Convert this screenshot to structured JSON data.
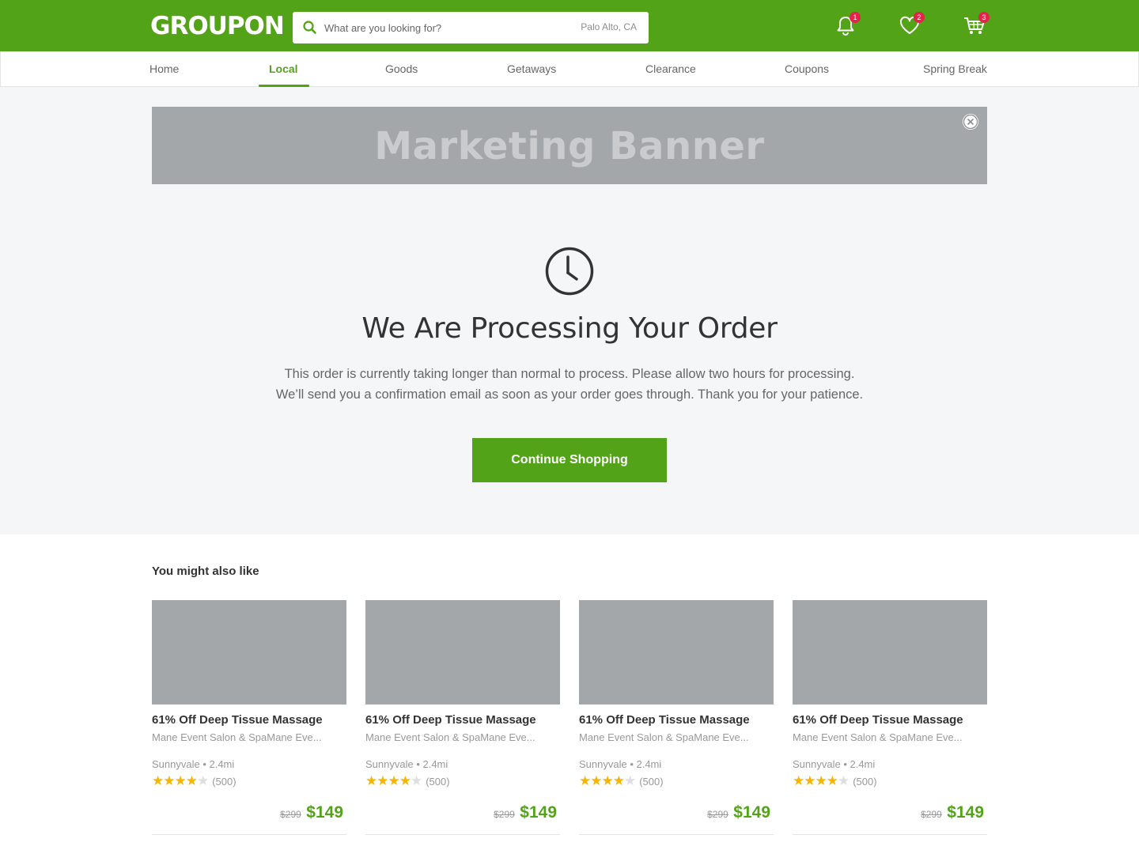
{
  "brand": {
    "logo_text": "GROUPON",
    "accent": "#53a318",
    "badge_color": "#e5234b"
  },
  "header": {
    "search_placeholder": "What are you looking for?",
    "location": "Palo Alto, CA",
    "search_icon": "search-icon",
    "notifications": {
      "icon": "bell-icon",
      "count": "1"
    },
    "wishlist": {
      "icon": "heart-icon",
      "count": "2"
    },
    "cart": {
      "icon": "cart-icon",
      "count": "3"
    }
  },
  "nav": {
    "active": "Local",
    "items": [
      "Home",
      "Local",
      "Goods",
      "Getaways",
      "Clearance",
      "Coupons",
      "Spring Break"
    ]
  },
  "banner": {
    "text": "Marketing Banner",
    "close_icon": "close-icon"
  },
  "processing": {
    "icon": "clock-icon",
    "title": "We Are Processing Your Order",
    "line1": "This order is currently taking longer than normal to process. Please allow two hours for processing.",
    "line2": "We’ll send you a confirmation email as soon as your order goes through. Thank you for your patience.",
    "cta": "Continue Shopping"
  },
  "recommendations": {
    "title": "You might also like",
    "cards": [
      {
        "title": "61% Off Deep Tissue Massage",
        "merchant": "Mane Event Salon & SpaMane Eve...",
        "location": "Sunnyvale • 2.4mi",
        "rating": 4,
        "reviews": "(500)",
        "old_price": "$299",
        "price": "$149"
      },
      {
        "title": "61% Off Deep Tissue Massage",
        "merchant": "Mane Event Salon & SpaMane Eve...",
        "location": "Sunnyvale • 2.4mi",
        "rating": 4,
        "reviews": "(500)",
        "old_price": "$299",
        "price": "$149"
      },
      {
        "title": "61% Off Deep Tissue Massage",
        "merchant": "Mane Event Salon & SpaMane Eve...",
        "location": "Sunnyvale • 2.4mi",
        "rating": 4,
        "reviews": "(500)",
        "old_price": "$299",
        "price": "$149"
      },
      {
        "title": "61% Off Deep Tissue Massage",
        "merchant": "Mane Event Salon & SpaMane Eve...",
        "location": "Sunnyvale • 2.4mi",
        "rating": 4,
        "reviews": "(500)",
        "old_price": "$299",
        "price": "$149"
      }
    ]
  }
}
